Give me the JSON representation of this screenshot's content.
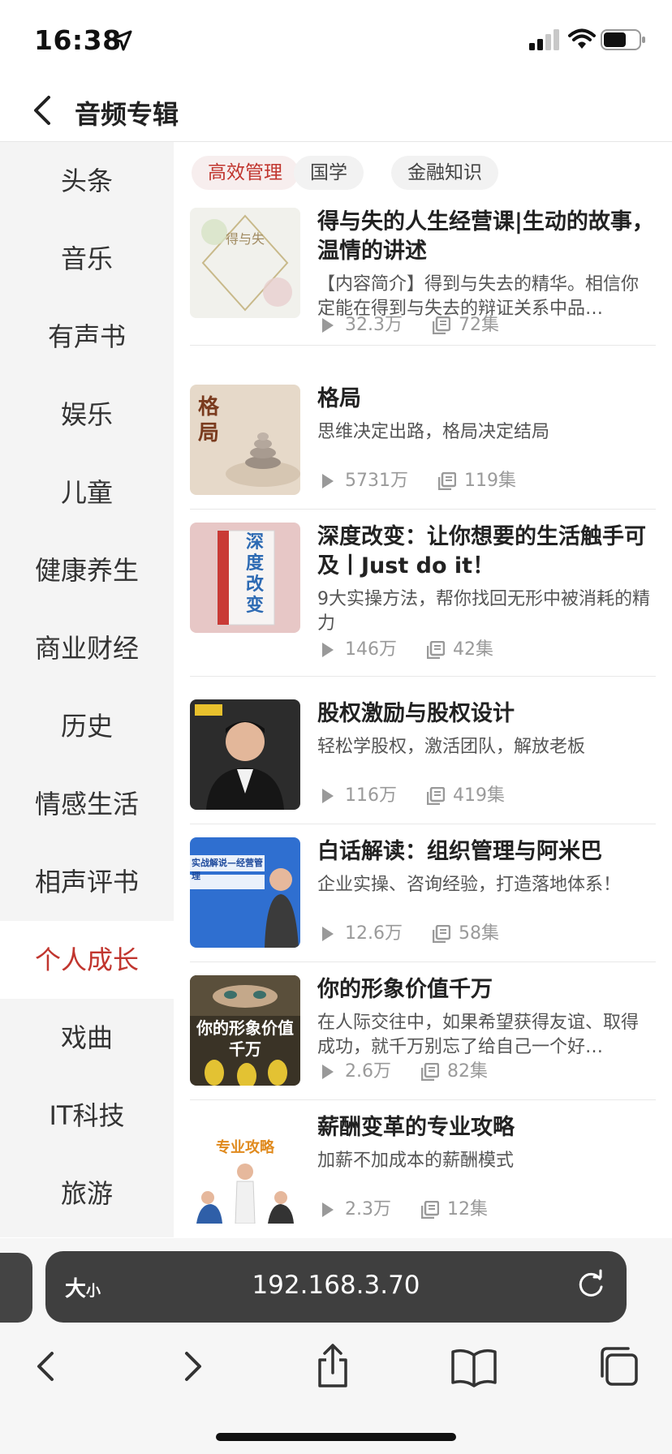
{
  "status": {
    "time": "16:38"
  },
  "nav": {
    "title": "音频专辑"
  },
  "sidebar": {
    "items": [
      {
        "label": "头条"
      },
      {
        "label": "音乐"
      },
      {
        "label": "有声书"
      },
      {
        "label": "娱乐"
      },
      {
        "label": "儿童"
      },
      {
        "label": "健康养生"
      },
      {
        "label": "商业财经"
      },
      {
        "label": "历史"
      },
      {
        "label": "情感生活"
      },
      {
        "label": "相声评书"
      },
      {
        "label": "个人成长",
        "active": true
      },
      {
        "label": "戏曲"
      },
      {
        "label": "IT科技"
      },
      {
        "label": "旅游"
      }
    ]
  },
  "tabs": [
    {
      "label": "高效管理",
      "active": true
    },
    {
      "label": "国学"
    },
    {
      "label": "金融知识"
    }
  ],
  "albums": [
    {
      "title": "得与失的人生经营课|生动的故事，温情的讲述",
      "desc": "【内容简介】得到与失去的精华。相信你定能在得到与失去的辩证关系中品…",
      "plays": "32.3万",
      "episodes": "72集",
      "cover_text": "得与失"
    },
    {
      "title": "格局",
      "desc": "思维决定出路，格局决定结局",
      "plays": "5731万",
      "episodes": "119集",
      "cover_text": "格局"
    },
    {
      "title": "深度改变：让你想要的生活触手可及丨Just do it！",
      "desc": "9大实操方法，帮你找回无形中被消耗的精力",
      "plays": "146万",
      "episodes": "42集",
      "cover_text": "深度改变"
    },
    {
      "title": "股权激励与股权设计",
      "desc": "轻松学股权，激活团队，解放老板",
      "plays": "116万",
      "episodes": "419集",
      "cover_text": ""
    },
    {
      "title": "白话解读：组织管理与阿米巴",
      "desc": "企业实操、咨询经验，打造落地体系！",
      "plays": "12.6万",
      "episodes": "58集",
      "cover_text": "实战解说—经营管理"
    },
    {
      "title": "你的形象价值千万",
      "desc": "在人际交往中，如果希望获得友谊、取得成功，就千万别忘了给自己一个好…",
      "plays": "2.6万",
      "episodes": "82集",
      "cover_text": "你的形象价值千万"
    },
    {
      "title": "薪酬变革的专业攻略",
      "desc": "加薪不加成本的薪酬模式",
      "plays": "2.3万",
      "episodes": "12集",
      "cover_text": "专业攻略"
    }
  ],
  "browser": {
    "text_size_label": "大",
    "text_size_small": "小",
    "url": "192.168.3.70"
  },
  "colors": {
    "accent": "#c1362f",
    "sidebar_bg": "#f4f4f4"
  }
}
